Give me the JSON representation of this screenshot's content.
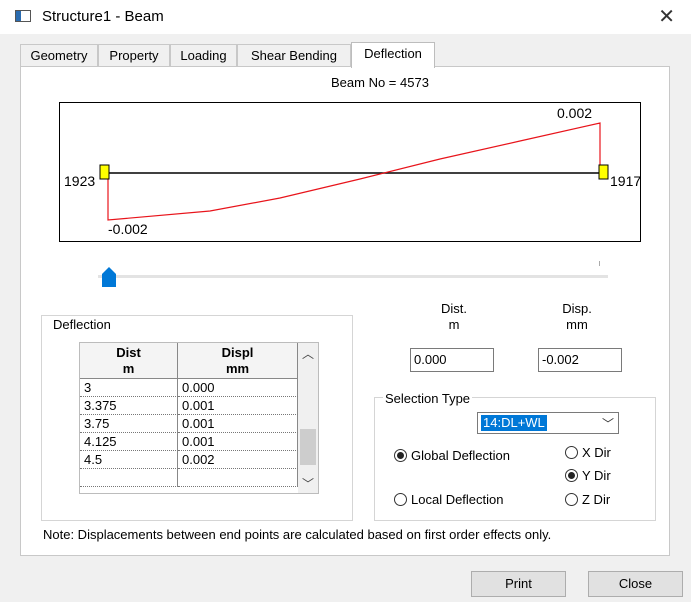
{
  "window": {
    "title": "Structure1 - Beam",
    "close_icon": "close-icon"
  },
  "tabs": [
    {
      "label": "Geometry"
    },
    {
      "label": "Property"
    },
    {
      "label": "Loading"
    },
    {
      "label": "Shear Bending"
    },
    {
      "label": "Deflection",
      "active": true
    }
  ],
  "beam_no": "Beam No = 4573",
  "diagram": {
    "start_node": "1923",
    "end_node": "1917",
    "max_label": "0.002",
    "min_label": "-0.002",
    "curve_color": "#e8141b",
    "support_color": "#ffff00"
  },
  "slider": {
    "position": 0.0,
    "thumb_color": "#0078d7"
  },
  "deflection_group": {
    "legend": "Deflection",
    "col_headers": [
      {
        "top": "Dist",
        "bottom": "m"
      },
      {
        "top": "Displ",
        "bottom": "mm"
      }
    ],
    "rows": [
      [
        "3",
        "0.000"
      ],
      [
        "3.375",
        "0.001"
      ],
      [
        "3.75",
        "0.001"
      ],
      [
        "4.125",
        "0.001"
      ],
      [
        "4.5",
        "0.002"
      ],
      [
        "",
        ""
      ]
    ]
  },
  "readout": {
    "dist_header_top": "Dist.",
    "dist_header_bottom": "m",
    "disp_header_top": "Disp.",
    "disp_header_bottom": "mm",
    "dist_value": "0.000",
    "disp_value": "-0.002"
  },
  "selection": {
    "legend": "Selection Type",
    "load_case": "14:DL+WL",
    "global_label": "Global Deflection",
    "local_label": "Local Deflection",
    "global_selected": true,
    "x_dir": "X Dir",
    "y_dir": "Y Dir",
    "z_dir": "Z Dir",
    "selected_dir": "Y Dir"
  },
  "note": "Note: Displacements between end points are calculated based on first order effects only.",
  "buttons": {
    "print": "Print",
    "close": "Close"
  }
}
